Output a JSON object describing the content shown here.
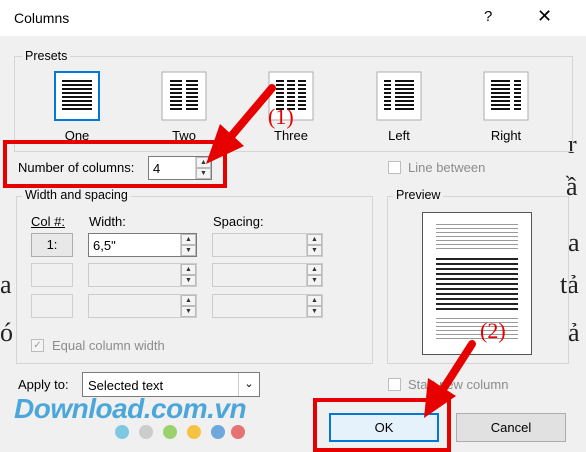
{
  "dialog": {
    "title": "Columns",
    "help_icon": "?",
    "close_icon": "✕"
  },
  "presets": {
    "label": "Presets",
    "items": [
      {
        "label": "One",
        "selected": true
      },
      {
        "label": "Two",
        "selected": false
      },
      {
        "label": "Three",
        "selected": false
      },
      {
        "label": "Left",
        "selected": false
      },
      {
        "label": "Right",
        "selected": false
      }
    ]
  },
  "number_of_columns": {
    "label": "Number of columns:",
    "value": "4"
  },
  "line_between": {
    "label": "Line between",
    "checked": false
  },
  "width_spacing": {
    "label": "Width and spacing",
    "col_header": "Col #:",
    "width_header": "Width:",
    "spacing_header": "Spacing:",
    "rows": [
      {
        "col": "1:",
        "width": "6,5\"",
        "spacing": ""
      },
      {
        "col": "",
        "width": "",
        "spacing": ""
      },
      {
        "col": "",
        "width": "",
        "spacing": ""
      }
    ]
  },
  "equal_column_width": {
    "label": "Equal column width",
    "checked": true
  },
  "preview": {
    "label": "Preview"
  },
  "apply_to": {
    "label": "Apply to:",
    "value": "Selected text"
  },
  "start_new_column": {
    "label": "Start new column",
    "checked": false
  },
  "buttons": {
    "ok": "OK",
    "cancel": "Cancel"
  },
  "annotations": {
    "step1": "(1)",
    "step2": "(2)",
    "color": "#e60000"
  },
  "background_letters": [
    "r",
    "ầ",
    "a",
    "tả",
    "ả",
    "ó"
  ],
  "watermark": {
    "text": "Download.com.vn",
    "dot_colors": [
      "#7ec8e3",
      "#cccccc",
      "#9bd26f",
      "#f5c242",
      "#6fa8dc",
      "#e57373"
    ]
  }
}
